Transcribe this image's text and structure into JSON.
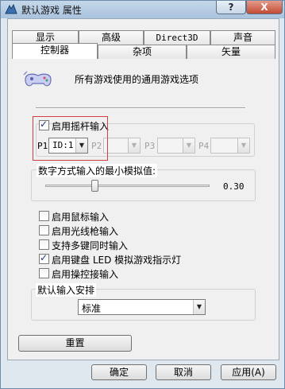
{
  "window": {
    "title": "默认游戏 属性",
    "help_label": "?",
    "close_label": "X"
  },
  "tabs_row1": [
    "显示",
    "高级",
    "Direct3D",
    "声音"
  ],
  "tabs_row2": [
    "控制器",
    "杂项",
    "矢量"
  ],
  "active_tab": "控制器",
  "controller": {
    "heading": "所有游戏使用的通用游戏选项",
    "enable_joystick_label": "启用摇杆输入",
    "enable_joystick_checked": true,
    "ports": [
      {
        "label": "P1",
        "value": "ID:1",
        "enabled": true
      },
      {
        "label": "P2",
        "value": "",
        "enabled": false
      },
      {
        "label": "P3",
        "value": "",
        "enabled": false
      },
      {
        "label": "P4",
        "value": "",
        "enabled": false
      }
    ],
    "analog_min_label": "数字方式输入的最小模拟值:",
    "analog_min_value": "0.30",
    "analog_min_fraction": 0.3,
    "options": [
      {
        "label": "启用鼠标输入",
        "checked": false
      },
      {
        "label": "启用光线枪输入",
        "checked": false
      },
      {
        "label": "支持多键同时输入",
        "checked": false
      },
      {
        "label": "启用键盘 LED 模拟游戏指示灯",
        "checked": true
      },
      {
        "label": "启用操控接输入",
        "checked": false
      }
    ],
    "default_input_label": "默认输入安排",
    "default_input_value": "标准",
    "reset_label": "重置"
  },
  "footer": {
    "ok_label": "确定",
    "cancel_label": "取消",
    "apply_label": "应用(A)"
  },
  "colors": {
    "highlight_border": "#d04040",
    "close_button": "#c24a33"
  }
}
